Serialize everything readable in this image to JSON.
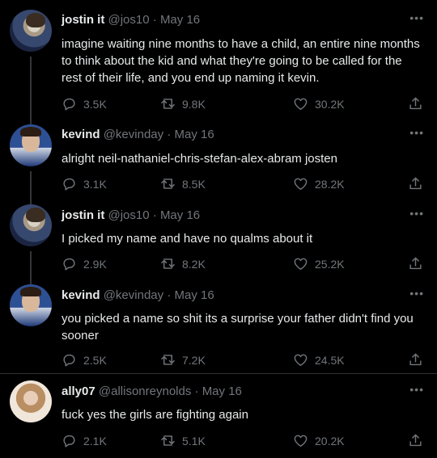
{
  "tweets": [
    {
      "name": "jostin it",
      "handle": "@jos10",
      "date": "May 16",
      "avatar": "jostin",
      "text": "imagine waiting nine months to have a child, an entire nine months to think about the kid and what they're going to be called for the rest of their life, and you end up naming it kevin.",
      "replies": "3.5K",
      "retweets": "9.8K",
      "likes": "30.2K"
    },
    {
      "name": "kevind",
      "handle": "@kevinday",
      "date": "May 16",
      "avatar": "kevin",
      "text": "alright neil-nathaniel-chris-stefan-alex-abram josten",
      "replies": "3.1K",
      "retweets": "8.5K",
      "likes": "28.2K"
    },
    {
      "name": "jostin it",
      "handle": "@jos10",
      "date": "May 16",
      "avatar": "jostin",
      "text": "I picked my name and have no qualms about it",
      "replies": "2.9K",
      "retweets": "8.2K",
      "likes": "25.2K"
    },
    {
      "name": "kevind",
      "handle": "@kevinday",
      "date": "May 16",
      "avatar": "kevin",
      "text": "you picked a name so shit its a surprise your father didn't find you sooner",
      "replies": "2.5K",
      "retweets": "7.2K",
      "likes": "24.5K"
    },
    {
      "name": "ally07",
      "handle": "@allisonreynolds",
      "date": "May 16",
      "avatar": "ally",
      "text": "fuck yes the girls are fighting again",
      "replies": "2.1K",
      "retweets": "5.1K",
      "likes": "20.2K"
    }
  ],
  "ui": {
    "separator": "·",
    "more_icon": "more-horizontal-icon",
    "text_color": "#e7e9ea",
    "muted_color": "#71767b",
    "background": "#000000"
  }
}
